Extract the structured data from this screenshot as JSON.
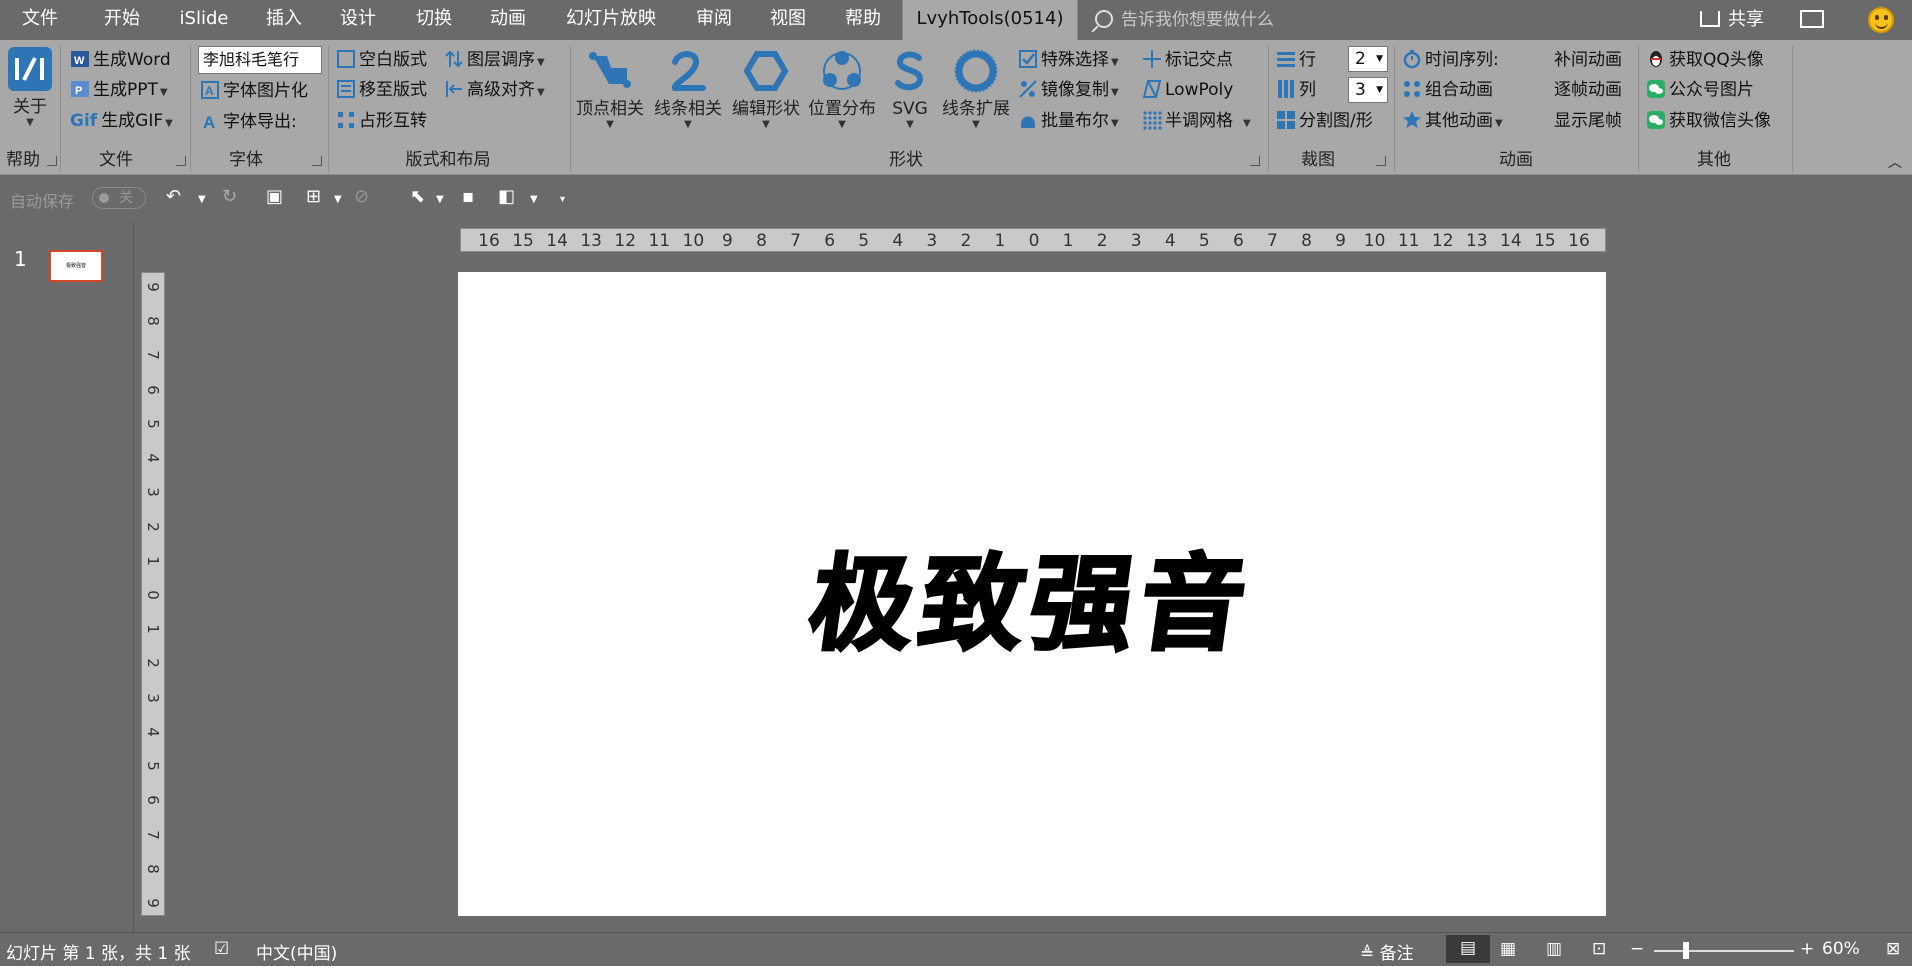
{
  "tabs": [
    "文件",
    "开始",
    "iSlide",
    "插入",
    "设计",
    "切换",
    "动画",
    "幻灯片放映",
    "审阅",
    "视图",
    "帮助",
    "LvyhTools(0514)"
  ],
  "tell_me": "告诉我你想要做什么",
  "share": "共享",
  "ribbon": {
    "help": {
      "about": "关于",
      "group": "帮助"
    },
    "file": {
      "word": "生成Word",
      "ppt": "生成PPT",
      "gif": "生成GIF",
      "gif_prefix": "Gif",
      "group": "文件"
    },
    "font": {
      "font_box": "李旭科毛笔行",
      "to_image": "字体图片化",
      "export": "字体导出:",
      "group": "字体"
    },
    "layout": {
      "blank": "空白版式",
      "move": "移至版式",
      "swap": "占形互转",
      "layer": "图层调序",
      "align": "高级对齐",
      "group": "版式和布局"
    },
    "shape": {
      "vertex": "顶点相关",
      "line": "线条相关",
      "edit": "编辑形状",
      "distribute": "位置分布",
      "svg": "SVG",
      "expand": "线条扩展",
      "special_select": "特殊选择",
      "mirror": "镜像复制",
      "boolean": "批量布尔",
      "mark": "标记交点",
      "lowpoly": "LowPoly",
      "halftone": "半调网格",
      "group": "形状"
    },
    "crop": {
      "rows_label": "行",
      "rows_value": "2",
      "cols_label": "列",
      "cols_value": "3",
      "split": "分割图/形",
      "group": "裁图"
    },
    "anim": {
      "timeline": "时间序列:",
      "combo": "组合动画",
      "other": "其他动画",
      "tween": "补间动画",
      "frame": "逐帧动画",
      "tail": "显示尾帧",
      "group": "动画"
    },
    "other": {
      "qq": "获取QQ头像",
      "wechat_pub": "公众号图片",
      "wechat": "获取微信头像",
      "group": "其他"
    }
  },
  "qat": {
    "autosave": "自动保存",
    "toggle": "关"
  },
  "slide_number": "1",
  "slide_title": "极致强音",
  "ruler": {
    "horizontal": [
      "16",
      "15",
      "14",
      "13",
      "12",
      "11",
      "10",
      "9",
      "8",
      "7",
      "6",
      "5",
      "4",
      "3",
      "2",
      "1",
      "0",
      "1",
      "2",
      "3",
      "4",
      "5",
      "6",
      "7",
      "8",
      "9",
      "10",
      "11",
      "12",
      "13",
      "14",
      "15",
      "16"
    ],
    "vertical": [
      "9",
      "8",
      "7",
      "6",
      "5",
      "4",
      "3",
      "2",
      "1",
      "0",
      "1",
      "2",
      "3",
      "4",
      "5",
      "6",
      "7",
      "8",
      "9"
    ]
  },
  "status": {
    "slide_info": "幻灯片 第 1 张，共 1 张",
    "language": "中文(中国)",
    "notes": "备注",
    "zoom": "60%",
    "zoom_fraction": 0.23
  },
  "colors": {
    "accent": "#2e75b6",
    "selection": "#d24726",
    "background": "#6a6a6a",
    "ribbon": "#a8a8a8"
  }
}
